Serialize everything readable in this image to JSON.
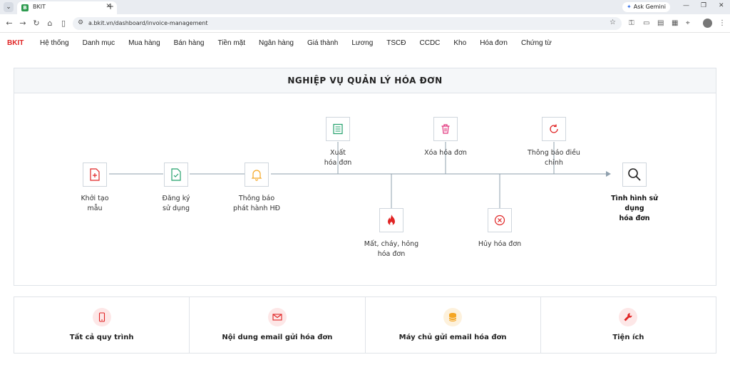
{
  "browser": {
    "tab_title": "BKIT",
    "favicon_letter": "B",
    "url": "a.bkit.vn/dashboard/invoice-management",
    "ask_gemini": "Ask Gemini"
  },
  "app": {
    "logo": "BKIT",
    "menu": [
      "Hệ thống",
      "Danh mục",
      "Mua hàng",
      "Bán hàng",
      "Tiền mặt",
      "Ngân hàng",
      "Giá thành",
      "Lương",
      "TSCĐ",
      "CCDC",
      "Kho",
      "Hóa đơn",
      "Chứng từ"
    ]
  },
  "panel": {
    "title": "NGHIỆP VỤ QUẢN LÝ HÓA ĐƠN"
  },
  "flow": {
    "nodes": [
      {
        "key": "khoi-tao-mau",
        "label": "Khởi tạo\nmẫu",
        "icon": "file-plus-icon",
        "color": "#e02424"
      },
      {
        "key": "dang-ky-su-dung",
        "label": "Đăng ký\nsử dụng",
        "icon": "file-check-icon",
        "color": "#22a06b"
      },
      {
        "key": "thong-bao-phat-hanh",
        "label": "Thông báo\nphát hành HĐ",
        "icon": "bell-icon",
        "color": "#f5a623"
      },
      {
        "key": "xuat-hoa-don",
        "label": "Xuất\nhóa đơn",
        "icon": "document-icon",
        "color": "#22a06b"
      },
      {
        "key": "xoa-hoa-don",
        "label": "Xóa hóa đơn",
        "icon": "trash-icon",
        "color": "#e0307a"
      },
      {
        "key": "thong-bao-dieu-chinh",
        "label": "Thông báo điều\nchỉnh",
        "icon": "refresh-icon",
        "color": "#e02424"
      },
      {
        "key": "mat-chay-hong",
        "label": "Mất, cháy, hỏng\nhóa đơn",
        "icon": "fire-icon",
        "color": "#e02424"
      },
      {
        "key": "huy-hoa-don",
        "label": "Hủy hóa đơn",
        "icon": "x-circle-icon",
        "color": "#e02424"
      },
      {
        "key": "tinh-hinh-su-dung",
        "label": "Tình hình sử\ndụng\nhóa đơn",
        "icon": "search-icon",
        "color": "#222222"
      }
    ]
  },
  "cards": [
    {
      "label": "Tất cả quy trình",
      "icon": "phone-icon",
      "color": "#e02424"
    },
    {
      "label": "Nội dung email gửi hóa đơn",
      "icon": "mail-icon",
      "color": "#e02424"
    },
    {
      "label": "Máy chủ gửi email hóa đơn",
      "icon": "database-icon",
      "color": "#f5a623"
    },
    {
      "label": "Tiện ích",
      "icon": "wrench-icon",
      "color": "#e02424"
    }
  ]
}
